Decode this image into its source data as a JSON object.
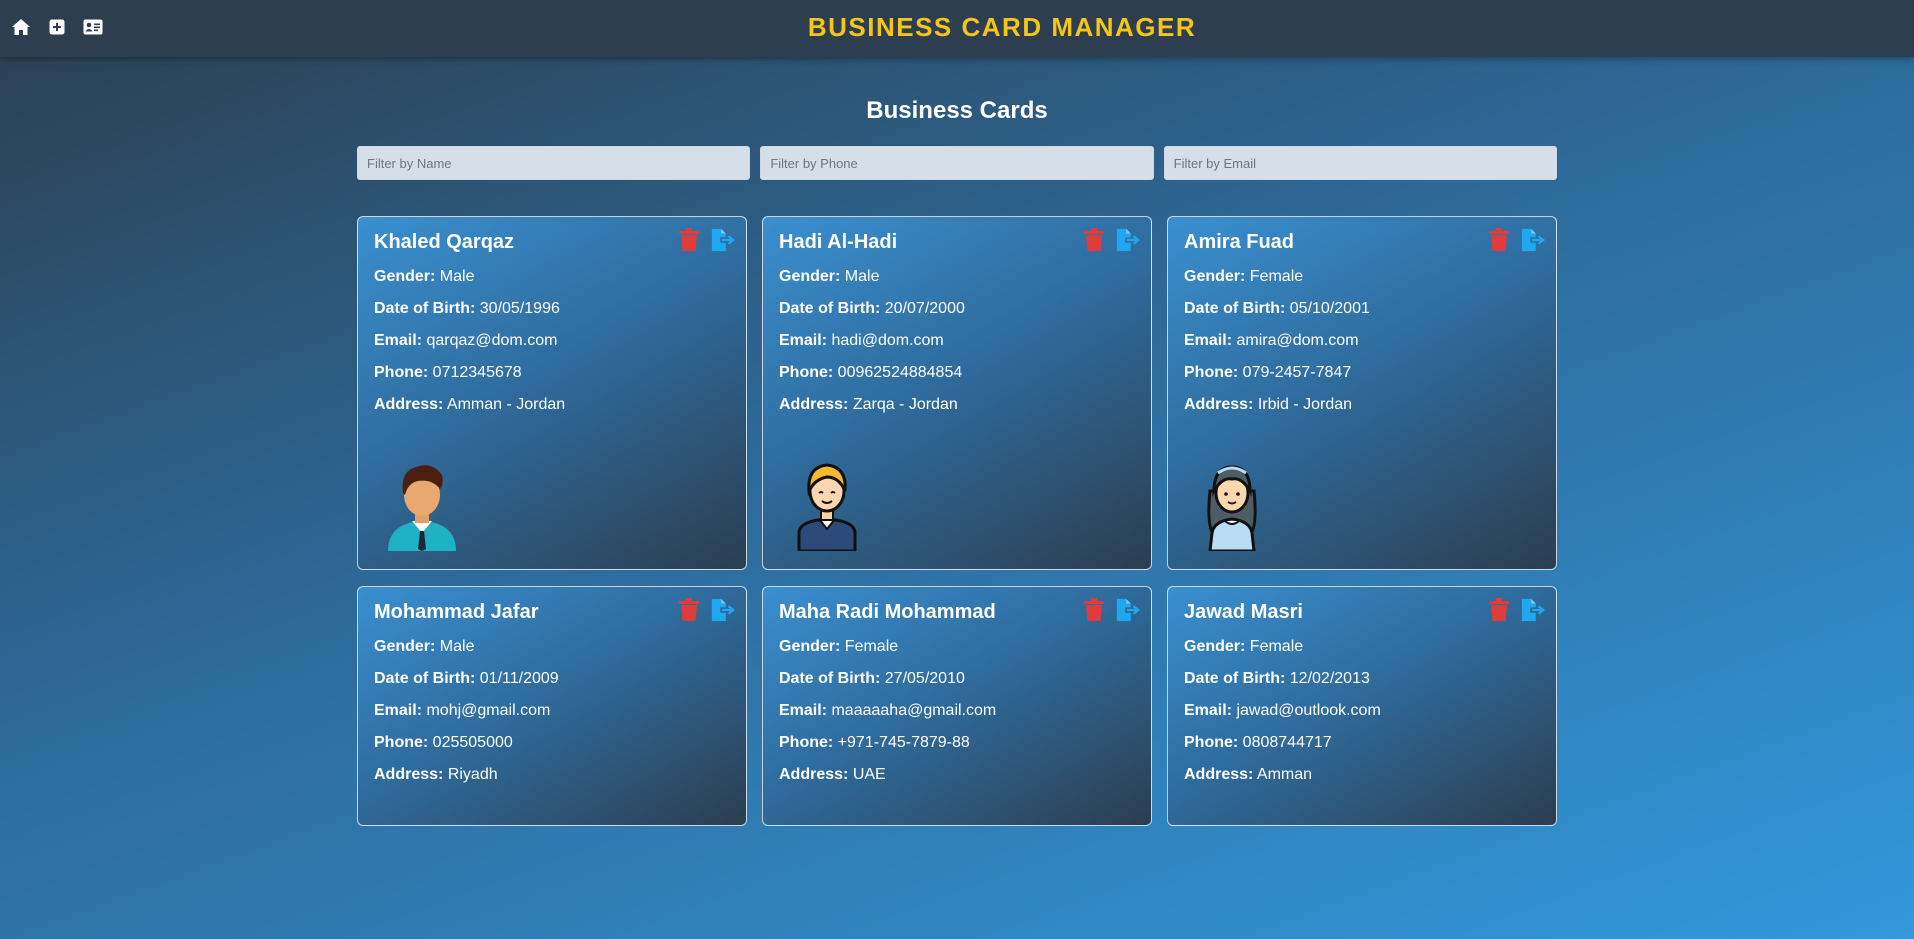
{
  "header": {
    "title": "BUSINESS CARD MANAGER",
    "nav": [
      {
        "icon": "home-icon"
      },
      {
        "icon": "add-icon"
      },
      {
        "icon": "contact-card-icon"
      }
    ]
  },
  "page": {
    "title": "Business Cards"
  },
  "filters": {
    "name_placeholder": "Filter by Name",
    "phone_placeholder": "Filter by Phone",
    "email_placeholder": "Filter by Email",
    "name_value": "",
    "phone_value": "",
    "email_value": ""
  },
  "labels": {
    "gender": "Gender:",
    "dob": "Date of Birth:",
    "email": "Email:",
    "phone": "Phone:",
    "address": "Address:"
  },
  "colors": {
    "accent": "#f5c518",
    "delete": "#e03c3c",
    "export": "#1fa8f0"
  },
  "cards": [
    {
      "name": "Khaled Qarqaz",
      "gender": "Male",
      "dob": "30/05/1996",
      "email": "qarqaz@dom.com",
      "phone": "0712345678",
      "address": "Amman - Jordan",
      "avatar": "man-suit-avatar-icon"
    },
    {
      "name": "Hadi Al-Hadi",
      "gender": "Male",
      "dob": "20/07/2000",
      "email": "hadi@dom.com",
      "phone": "00962524884854",
      "address": "Zarqa - Jordan",
      "avatar": "boy-blonde-avatar-icon"
    },
    {
      "name": "Amira Fuad",
      "gender": "Female",
      "dob": "05/10/2001",
      "email": "amira@dom.com",
      "phone": "079-2457-7847",
      "address": "Irbid - Jordan",
      "avatar": "girl-avatar-icon"
    },
    {
      "name": "Mohammad Jafar",
      "gender": "Male",
      "dob": "01/11/2009",
      "email": "mohj@gmail.com",
      "phone": "025505000",
      "address": "Riyadh"
    },
    {
      "name": "Maha Radi Mohammad",
      "gender": "Female",
      "dob": "27/05/2010",
      "email": "maaaaaha@gmail.com",
      "phone": "+971-745-7879-88",
      "address": "UAE"
    },
    {
      "name": "Jawad Masri",
      "gender": "Female",
      "dob": "12/02/2013",
      "email": "jawad@outlook.com",
      "phone": "0808744717",
      "address": "Amman"
    }
  ]
}
